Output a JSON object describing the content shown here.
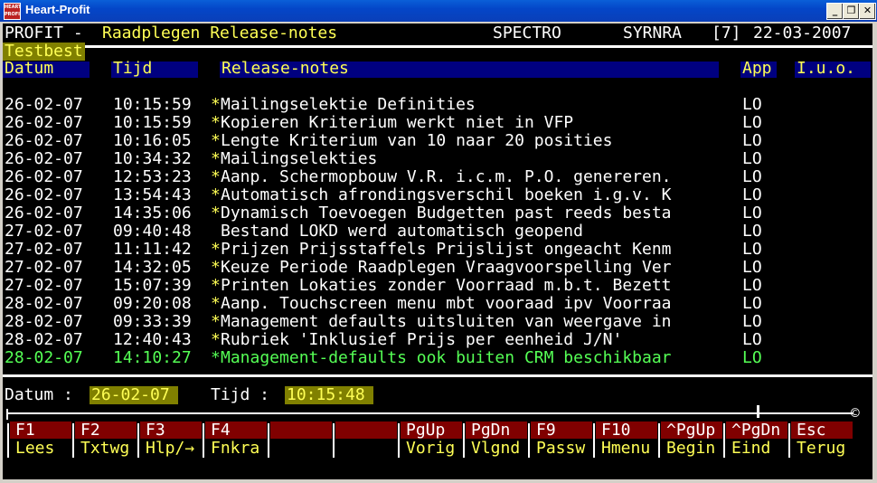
{
  "window": {
    "title": "Heart-Profit",
    "icon": "HEART PROFIT"
  },
  "header": {
    "app": "PROFIT -",
    "screen_title": "Raadplegen Release-notes",
    "system": "SPECTRO",
    "user": "SYRNRA",
    "session": "[7]",
    "date": "22-03-2007",
    "env": "Testbest"
  },
  "columns": {
    "datum": "Datum",
    "tijd": "Tijd",
    "notes": "Release-notes",
    "app": "App",
    "iuo": "I.u.o."
  },
  "rows": [
    {
      "datum": "26-02-07",
      "tijd": "10:15:59",
      "note": "*Mailingselektie Definities",
      "app": "LO"
    },
    {
      "datum": "26-02-07",
      "tijd": "10:15:59",
      "note": "*Kopieren Kriterium werkt niet in VFP",
      "app": "LO"
    },
    {
      "datum": "26-02-07",
      "tijd": "10:16:05",
      "note": "*Lengte Kriterium van 10 naar 20 posities",
      "app": "LO"
    },
    {
      "datum": "26-02-07",
      "tijd": "10:34:32",
      "note": "*Mailingselekties",
      "app": "LO"
    },
    {
      "datum": "26-02-07",
      "tijd": "12:53:23",
      "note": "*Aanp. Schermopbouw V.R. i.c.m. P.O. genereren.",
      "app": "LO"
    },
    {
      "datum": "26-02-07",
      "tijd": "13:54:43",
      "note": "*Automatisch afrondingsverschil boeken i.g.v. K",
      "app": "LO"
    },
    {
      "datum": "26-02-07",
      "tijd": "14:35:06",
      "note": "*Dynamisch Toevoegen Budgetten past reeds besta",
      "app": "LO"
    },
    {
      "datum": "27-02-07",
      "tijd": "09:40:48",
      "note": " Bestand LOKD werd automatisch geopend",
      "app": "LO"
    },
    {
      "datum": "27-02-07",
      "tijd": "11:11:42",
      "note": "*Prijzen Prijsstaffels Prijslijst ongeacht Kenm",
      "app": "LO"
    },
    {
      "datum": "27-02-07",
      "tijd": "14:32:05",
      "note": "*Keuze Periode Raadplegen Vraagvoorspelling Ver",
      "app": "LO"
    },
    {
      "datum": "27-02-07",
      "tijd": "15:07:39",
      "note": "*Printen Lokaties zonder Voorraad m.b.t. Bezett",
      "app": "LO"
    },
    {
      "datum": "28-02-07",
      "tijd": "09:20:08",
      "note": "*Aanp. Touchscreen menu mbt vooraad ipv Voorraa",
      "app": "LO"
    },
    {
      "datum": "28-02-07",
      "tijd": "09:33:39",
      "note": "*Management defaults uitsluiten van weergave in",
      "app": "LO"
    },
    {
      "datum": "28-02-07",
      "tijd": "12:40:43",
      "note": "*Rubriek 'Inklusief Prijs per eenheid J/N'",
      "app": "LO"
    },
    {
      "datum": "28-02-07",
      "tijd": "14:10:27",
      "note": "*Management-defaults ook buiten CRM beschikbaar",
      "app": "LO",
      "selected": true
    }
  ],
  "footer": {
    "datum_label": "Datum :",
    "datum_value": "26-02-07",
    "tijd_label": "Tijd :",
    "tijd_value": "10:15:48",
    "scroll_end": "©"
  },
  "fkeys": [
    {
      "key": "F1",
      "label": "Lees"
    },
    {
      "key": "F2",
      "label": "Txtwg"
    },
    {
      "key": "F3",
      "label": "Hlp/→"
    },
    {
      "key": "F4",
      "label": "Fnkra"
    },
    {
      "key": "",
      "label": ""
    },
    {
      "key": "",
      "label": ""
    },
    {
      "key": "PgUp",
      "label": "Vorig"
    },
    {
      "key": "PgDn",
      "label": "Vlgnd"
    },
    {
      "key": "F9",
      "label": "Passw"
    },
    {
      "key": "F10",
      "label": "Hmenu"
    },
    {
      "key": "^PgUp",
      "label": "Begin"
    },
    {
      "key": "^PgDn",
      "label": "Eind"
    },
    {
      "key": "Esc",
      "label": "Terug"
    }
  ]
}
